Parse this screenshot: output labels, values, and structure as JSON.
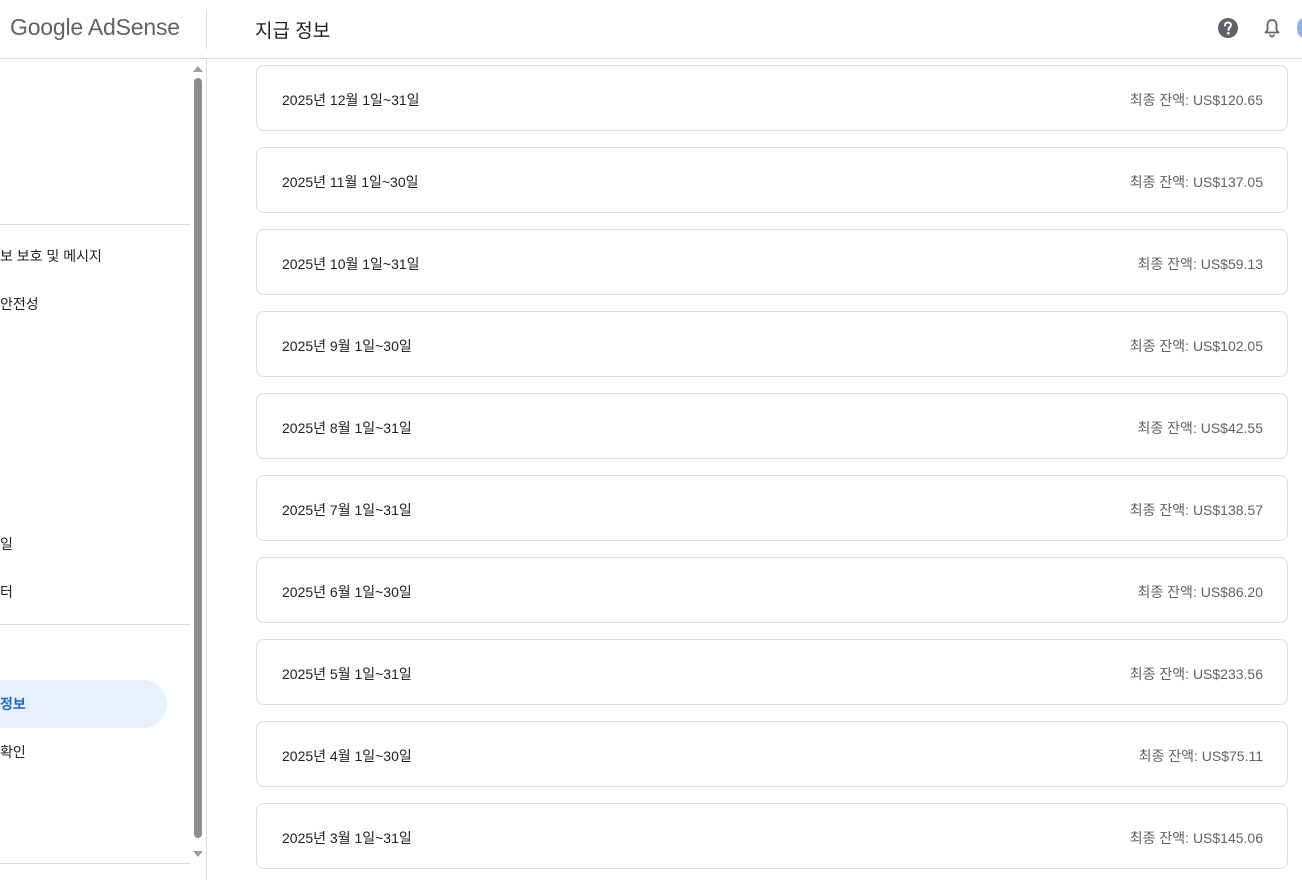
{
  "header": {
    "logo_google": "Google",
    "logo_product": "AdSense",
    "title": "지급 정보"
  },
  "icons": {
    "help": "help-circle-icon",
    "notifications": "bell-icon"
  },
  "sidebar": {
    "items": [
      {
        "label": "보 보호 및 메시지",
        "active": false
      },
      {
        "label": "안전성",
        "active": false
      },
      {
        "label": "일",
        "active": false
      },
      {
        "label": "터",
        "active": false
      },
      {
        "label": "정보",
        "active": true
      },
      {
        "label": "확인",
        "active": false
      }
    ]
  },
  "colors": {
    "active_bg": "#e8f0fe",
    "active_text": "#1967d2",
    "border": "#dadce0",
    "secondary_text": "#5f6368"
  },
  "payments": [
    {
      "period": "2025년 12월 1일~31일",
      "balance": "최종 잔액: US$120.65"
    },
    {
      "period": "2025년 11월 1일~30일",
      "balance": "최종 잔액: US$137.05"
    },
    {
      "period": "2025년 10월 1일~31일",
      "balance": "최종 잔액: US$59.13"
    },
    {
      "period": "2025년 9월 1일~30일",
      "balance": "최종 잔액: US$102.05"
    },
    {
      "period": "2025년 8월 1일~31일",
      "balance": "최종 잔액: US$42.55"
    },
    {
      "period": "2025년 7월 1일~31일",
      "balance": "최종 잔액: US$138.57"
    },
    {
      "period": "2025년 6월 1일~30일",
      "balance": "최종 잔액: US$86.20"
    },
    {
      "period": "2025년 5월 1일~31일",
      "balance": "최종 잔액: US$233.56"
    },
    {
      "period": "2025년 4월 1일~30일",
      "balance": "최종 잔액: US$75.11"
    },
    {
      "period": "2025년 3월 1일~31일",
      "balance": "최종 잔액: US$145.06"
    }
  ]
}
